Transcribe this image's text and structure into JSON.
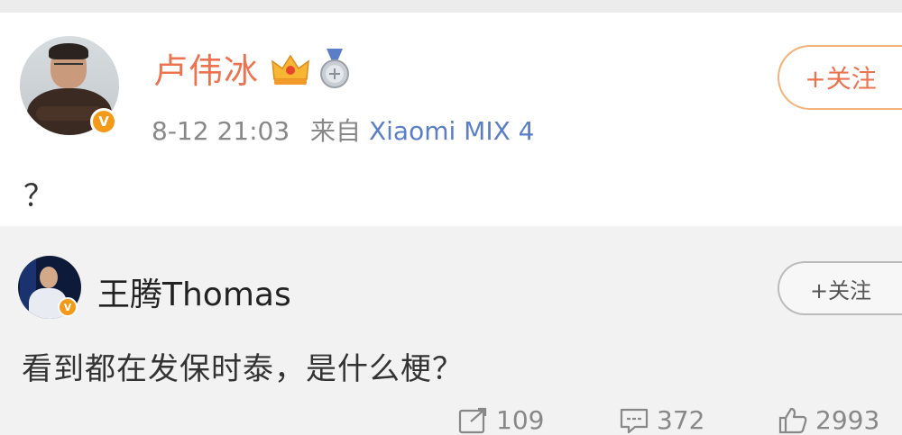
{
  "post": {
    "author": "卢伟冰",
    "timestamp": "8-12 21:03",
    "source_prefix": "来自",
    "source_device": "Xiaomi MIX 4",
    "follow_label": "+关注",
    "text": "？",
    "verified_badge": "V"
  },
  "comment": {
    "author": "王腾Thomas",
    "follow_label": "+关注",
    "text": "看到都在发保时泰，是什么梗？",
    "verified_badge": "V"
  },
  "actions": {
    "reposts": "109",
    "comments": "372",
    "likes": "2993"
  },
  "icons": {
    "crown": "crown-icon",
    "medal": "medal-icon",
    "repost": "repost-icon",
    "comment": "comment-icon",
    "like": "like-icon"
  },
  "colors": {
    "accent": "#eb7350",
    "link": "#5b7fc7",
    "verified": "#f59a18",
    "meta": "#888888"
  }
}
